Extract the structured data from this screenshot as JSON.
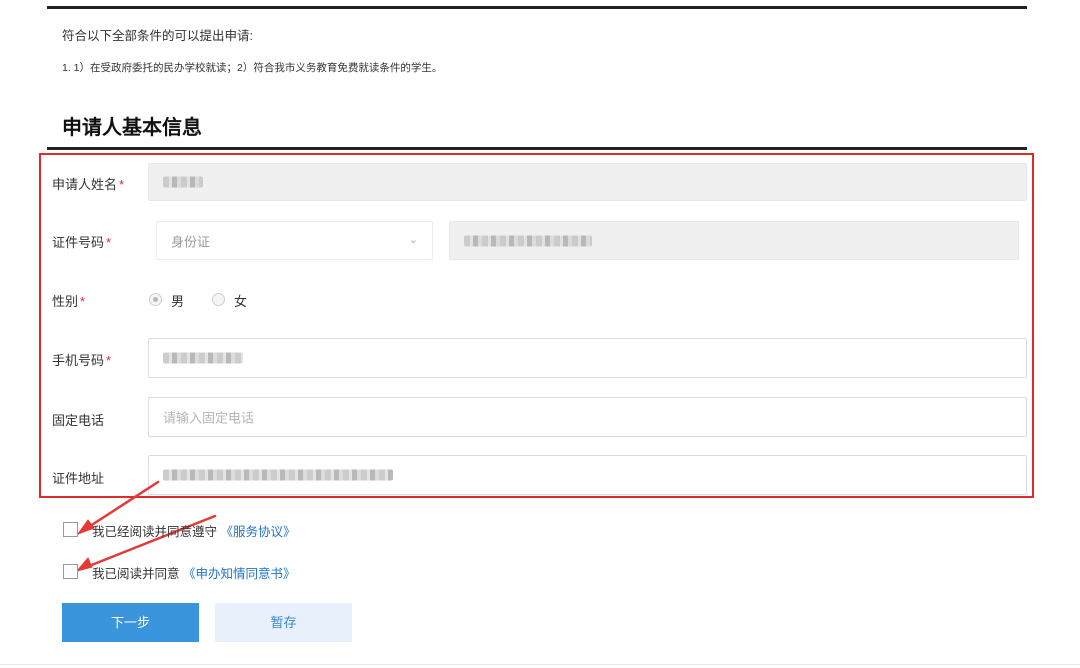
{
  "notice": {
    "title": "符合以下全部条件的可以提出申请:",
    "body": "1. 1）在受政府委托的民办学校就读；2）符合我市义务教育免费就读条件的学生。"
  },
  "section": {
    "title": "申请人基本信息"
  },
  "form": {
    "required_mark": "*",
    "name": {
      "label": "申请人姓名"
    },
    "id": {
      "label": "证件号码",
      "type_value": "身份证",
      "chevron_icon": "chevron-down-icon"
    },
    "gender": {
      "label": "性别",
      "options": [
        "男",
        "女"
      ],
      "selected": "男"
    },
    "mobile": {
      "label": "手机号码"
    },
    "landline": {
      "label": "固定电话",
      "placeholder": "请输入固定电话"
    },
    "address": {
      "label": "证件地址"
    }
  },
  "agreements": {
    "service_prefix": "我已经阅读并同意遵守",
    "service_link": "《服务协议》",
    "consent_prefix": "我已阅读并同意",
    "consent_link": "《申办知情同意书》"
  },
  "buttons": {
    "next": "下一步",
    "save": "暂存"
  },
  "colors": {
    "accent": "#3a95dd",
    "highlight": "#e02b2b",
    "link": "#1f74c4"
  }
}
